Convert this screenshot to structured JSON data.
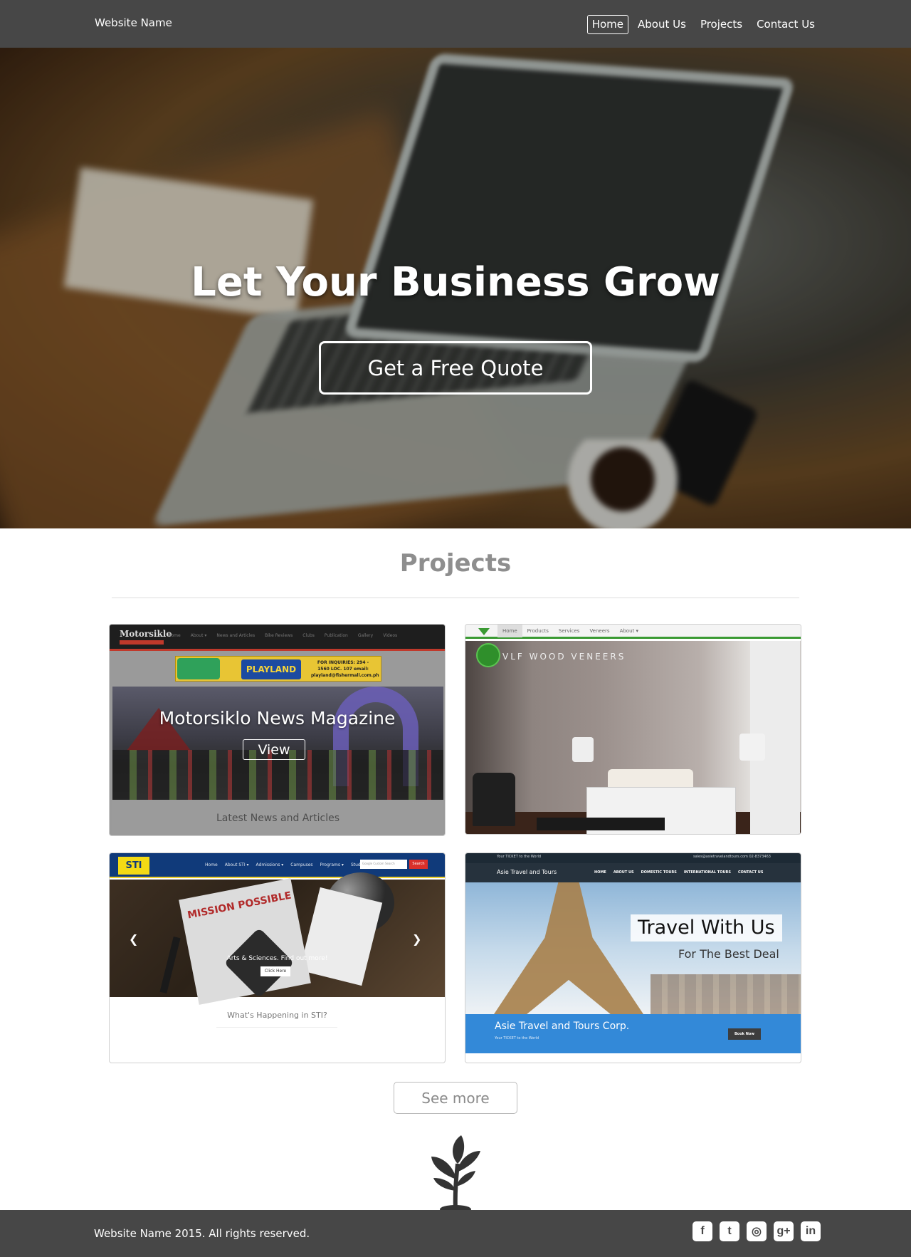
{
  "nav": {
    "brand": "Website Name",
    "items": [
      {
        "label": "Home",
        "active": true
      },
      {
        "label": "About Us"
      },
      {
        "label": "Projects"
      },
      {
        "label": "Contact Us"
      }
    ]
  },
  "hero": {
    "headline": "Let Your Business Grow",
    "cta": "Get a Free Quote"
  },
  "projects": {
    "title": "Projects",
    "cards": [
      {
        "site_logo": "Motorsiklo",
        "site_menu": [
          "Home",
          "About ▾",
          "News and Articles",
          "Bike Reviews",
          "Clubs",
          "Publication",
          "Gallery",
          "Videos"
        ],
        "banner_mid": "PLAYLAND",
        "banner_right": "FOR INQUIRIES: 294 - 1560 LOC. 107 email: playland@fishermall.com.ph",
        "overlay_title": "Motorsiklo News Magazine",
        "view_label": "View",
        "caption": "Latest News and Articles"
      },
      {
        "site_menu": [
          "Home",
          "Products",
          "Services",
          "Veneers",
          "About ▾"
        ],
        "brand_text": "VLF WOOD VENEERS"
      },
      {
        "site_logo": "STI",
        "site_menu": [
          "Home",
          "About STI ▾",
          "Admissions ▾",
          "Campuses",
          "Programs ▾",
          "Students ▾"
        ],
        "search_placeholder": "Google Custom Search",
        "search_button": "Search",
        "paper_title": "MISSION POSSIBLE",
        "slide_text": "Arts & Sciences. Find out more!",
        "slide_button": "Click Here",
        "caption": "What's Happening in STI?"
      },
      {
        "top_left": "Your TICKET to the World",
        "top_right": "sales@asietravelandtours.com  02-8373463",
        "brand": "Asie Travel and Tours",
        "site_menu": [
          "HOME",
          "ABOUT US",
          "DOMESTIC TOURS",
          "INTERNATIONAL TOURS",
          "CONTACT US"
        ],
        "headline": "Travel With Us",
        "subline": "For The Best Deal",
        "corp": "Asie Travel and Tours Corp.",
        "corp_sub": "Your TICKET to the World",
        "book": "Book Now"
      }
    ],
    "see_more": "See more"
  },
  "footer": {
    "copyright": "Website Name 2015. All rights reserved.",
    "socials": [
      {
        "icon": "facebook-icon",
        "glyph": "f"
      },
      {
        "icon": "twitter-icon",
        "glyph": "t"
      },
      {
        "icon": "instagram-icon",
        "glyph": "◎"
      },
      {
        "icon": "google-plus-icon",
        "glyph": "g+"
      },
      {
        "icon": "linkedin-icon",
        "glyph": "in"
      }
    ]
  },
  "colors": {
    "navbar": "#474747",
    "footer": "#474747",
    "projects_title": "#8e8e8e"
  }
}
